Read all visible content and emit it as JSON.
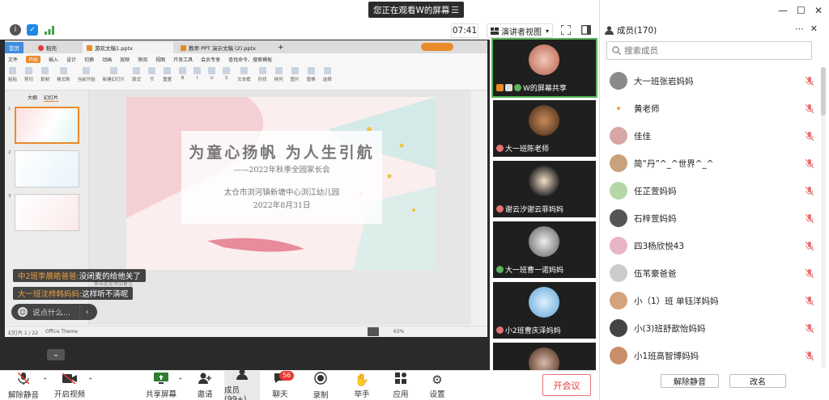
{
  "banner": {
    "text": "您正在观看W的屏幕",
    "menu_icon": "menu-icon"
  },
  "toolbar": {
    "time": "07:41",
    "view_mode": "演讲者视图",
    "icons": [
      "info-icon",
      "shield-icon",
      "signal-icon",
      "fullscreen-icon",
      "layout-icon"
    ]
  },
  "ppt": {
    "tabs": [
      "首页",
      "稻壳",
      "游欢文稿1.pptx",
      "教师 PPT 演示文稿 (2).pptx",
      "+"
    ],
    "menu": [
      "文件",
      "开始",
      "插入",
      "设计",
      "切换",
      "动画",
      "放映",
      "审阅",
      "视图",
      "开发工具",
      "会员专享",
      "查找命令、搜索模板"
    ],
    "active_menu": "开始",
    "tools": [
      "粘贴",
      "剪切",
      "复制",
      "格式刷",
      "当前开始",
      "新建幻灯片",
      "版式",
      "节",
      "重置",
      "B",
      "I",
      "U",
      "S",
      "文本框",
      "形状",
      "排列",
      "图片",
      "替换",
      "选择"
    ],
    "side_tabs": [
      "大纲",
      "幻灯片"
    ],
    "thumb_numbers": [
      "1",
      "2",
      "3"
    ],
    "slide": {
      "title": "为童心扬帆 为人生引航",
      "subtitle": "——2022年秋季全园家长会",
      "org": "太仓市浏河镇新塘中心浏江幼儿园",
      "date": "2022年8月31日"
    },
    "notes": "单击此处添加备注",
    "status": {
      "page": "幻灯片 1 / 22",
      "theme": "Office Theme",
      "zoom": "63%"
    }
  },
  "chat": {
    "messages": [
      {
        "who": "中2班李晨皓爸爸:",
        "text": "没闭麦的给他关了"
      },
      {
        "who": "大一班沈梓韩妈妈:",
        "text": "这样听不清呢"
      }
    ],
    "input_placeholder": "说点什么..."
  },
  "video_tiles": [
    {
      "label": "W的屏幕共享",
      "accent": "#e98a2a",
      "active": true
    },
    {
      "label": "大一班陈老师",
      "accent": "#e57373",
      "active": false
    },
    {
      "label": "谢云汐谢云菲妈妈",
      "accent": "#e57373",
      "active": false
    },
    {
      "label": "大一班曹一诺妈妈",
      "accent": "#5ab55a",
      "active": false
    },
    {
      "label": "小2班曹庆泽妈妈",
      "accent": "#e57373",
      "active": false
    }
  ],
  "bottom": {
    "mute": "解除静音",
    "video": "开启视频",
    "share": "共享屏幕",
    "invite": "邀请",
    "members": "成员(99+)",
    "chat": "聊天",
    "chat_badge": "56",
    "record": "录制",
    "hand": "举手",
    "apps": "应用",
    "settings": "设置",
    "leave": "开会议"
  },
  "panel": {
    "title": "成员(170)",
    "search_placeholder": "搜索成员",
    "members": [
      {
        "name": "大一班张岩妈妈",
        "color": "#8a8a8a"
      },
      {
        "name": "黄老师",
        "color": ""
      },
      {
        "name": "佳佳",
        "color": "#d9a6a6"
      },
      {
        "name": "简“丹”^_^世界^_^",
        "color": "#c7a27c"
      },
      {
        "name": "任芷萱妈妈",
        "color": "#b5d7a8"
      },
      {
        "name": "石梓萱妈妈",
        "color": "#555555"
      },
      {
        "name": "四3杨欣悦43",
        "color": "#e8b4c8"
      },
      {
        "name": "伍苇豪爸爸",
        "color": "#cccccc"
      },
      {
        "name": "小（1）班 单钰洋妈妈",
        "color": "#d4a27c"
      },
      {
        "name": "小(3)班舒歆怡妈妈",
        "color": "#444444"
      },
      {
        "name": "小1班高智博妈妈",
        "color": "#c98f6a"
      }
    ],
    "unmute_all": "解除静音",
    "rename": "改名"
  }
}
